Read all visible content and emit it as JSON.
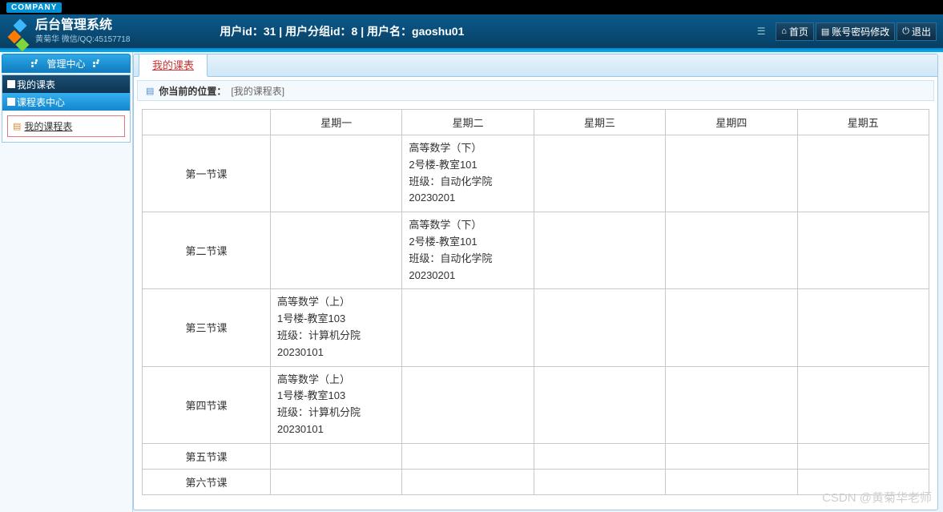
{
  "company_badge": "COMPANY",
  "header": {
    "title": "后台管理系统",
    "subtitle": "黄菊华 微信/QQ:45157718",
    "user_info": "用户id：31 | 用户分组id：8 | 用户名：gaoshu01",
    "actions": {
      "home": "首页",
      "password": "账号密码修改",
      "logout": "退出"
    }
  },
  "sidebar": {
    "title": "管理中心",
    "panel1_title": "我的课表",
    "panel2_title": "课程表中心",
    "link1": "我的课程表"
  },
  "tabs": {
    "active": "我的课表"
  },
  "breadcrumb": {
    "label": "你当前的位置：",
    "location": "[我的课程表]"
  },
  "table": {
    "headers": [
      "星期一",
      "星期二",
      "星期三",
      "星期四",
      "星期五"
    ],
    "rows": [
      {
        "name": "第一节课",
        "cells": [
          "",
          "高等数学（下）\n2号楼-教室101\n班级：自动化学院\n20230201",
          "",
          "",
          ""
        ]
      },
      {
        "name": "第二节课",
        "cells": [
          "",
          "高等数学（下）\n2号楼-教室101\n班级：自动化学院\n20230201",
          "",
          "",
          ""
        ]
      },
      {
        "name": "第三节课",
        "cells": [
          "高等数学（上）\n1号楼-教室103\n班级：计算机分院\n20230101",
          "",
          "",
          "",
          ""
        ]
      },
      {
        "name": "第四节课",
        "cells": [
          "高等数学（上）\n1号楼-教室103\n班级：计算机分院\n20230101",
          "",
          "",
          "",
          ""
        ]
      },
      {
        "name": "第五节课",
        "cells": [
          "",
          "",
          "",
          "",
          ""
        ]
      },
      {
        "name": "第六节课",
        "cells": [
          "",
          "",
          "",
          "",
          ""
        ]
      }
    ]
  },
  "watermark": "CSDN @黄菊华老师"
}
